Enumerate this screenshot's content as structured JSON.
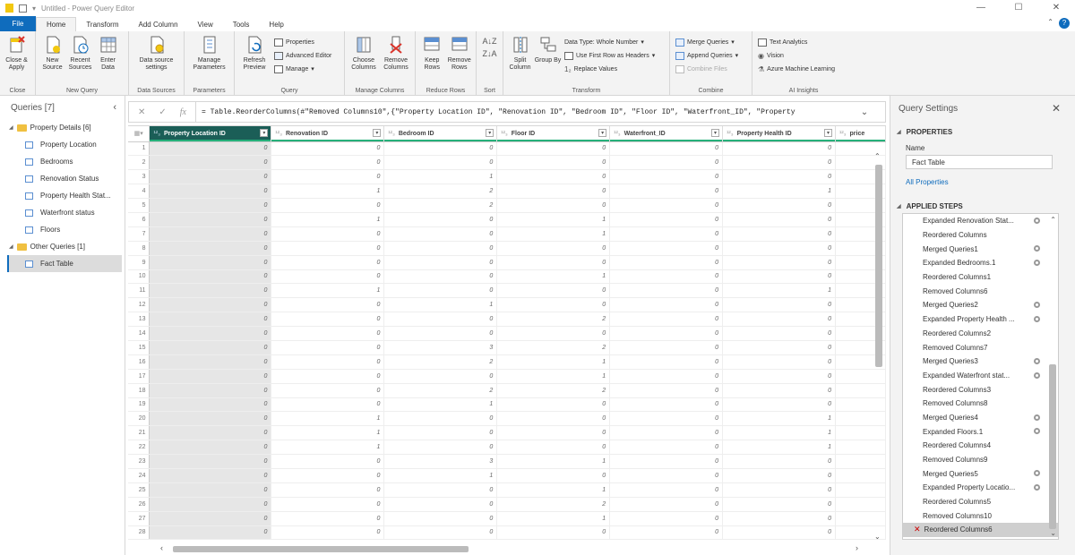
{
  "title": "Untitled - Power Query Editor",
  "window_controls": {
    "minimize": "—",
    "maximize": "☐",
    "close": "✕"
  },
  "tabs": [
    "File",
    "Home",
    "Transform",
    "Add Column",
    "View",
    "Tools",
    "Help"
  ],
  "ribbon": {
    "close": {
      "label": "Close",
      "btn": "Close & Apply"
    },
    "new_query": {
      "label": "New Query",
      "btns": [
        "New Source",
        "Recent Sources",
        "Enter Data"
      ]
    },
    "data_sources": {
      "label": "Data Sources",
      "btn": "Data source settings"
    },
    "parameters": {
      "label": "Parameters",
      "btn": "Manage Parameters"
    },
    "query": {
      "label": "Query",
      "btn": "Refresh Preview",
      "small": [
        "Properties",
        "Advanced Editor",
        "Manage"
      ]
    },
    "manage_columns": {
      "label": "Manage Columns",
      "btns": [
        "Choose Columns",
        "Remove Columns"
      ]
    },
    "reduce_rows": {
      "label": "Reduce Rows",
      "btns": [
        "Keep Rows",
        "Remove Rows"
      ]
    },
    "sort": {
      "label": "Sort"
    },
    "transform": {
      "label": "Transform",
      "btns": [
        "Split Column",
        "Group By"
      ],
      "small": [
        "Data Type: Whole Number",
        "Use First Row as Headers",
        "Replace Values"
      ]
    },
    "combine": {
      "label": "Combine",
      "small": [
        "Merge Queries",
        "Append Queries",
        "Combine Files"
      ]
    },
    "ai": {
      "label": "AI Insights",
      "small": [
        "Text Analytics",
        "Vision",
        "Azure Machine Learning"
      ]
    }
  },
  "queries": {
    "header": "Queries [7]",
    "groups": [
      {
        "name": "Property Details [6]",
        "items": [
          "Property Location",
          "Bedrooms",
          "Renovation Status",
          "Property Health Stat...",
          "Waterfront status",
          "Floors"
        ]
      },
      {
        "name": "Other Queries [1]",
        "items": [
          "Fact Table"
        ]
      }
    ]
  },
  "formula": "= Table.ReorderColumns(#\"Removed Columns10\",{\"Property Location ID\", \"Renovation ID\", \"Bedroom ID\", \"Floor ID\", \"Waterfront_ID\", \"Property",
  "columns": [
    "Property Location ID",
    "Renovation ID",
    "Bedroom ID",
    "Floor ID",
    "Waterfront_ID",
    "Property Health ID",
    "price"
  ],
  "column_type_icon": "¹²₃",
  "rows": [
    [
      0,
      0,
      0,
      0,
      0,
      0
    ],
    [
      0,
      0,
      0,
      0,
      0,
      0
    ],
    [
      0,
      0,
      1,
      0,
      0,
      0
    ],
    [
      0,
      1,
      2,
      0,
      0,
      1
    ],
    [
      0,
      0,
      2,
      0,
      0,
      0
    ],
    [
      0,
      1,
      0,
      1,
      0,
      0
    ],
    [
      0,
      0,
      0,
      1,
      0,
      0
    ],
    [
      0,
      0,
      0,
      0,
      0,
      0
    ],
    [
      0,
      0,
      0,
      0,
      0,
      0
    ],
    [
      0,
      0,
      0,
      1,
      0,
      0
    ],
    [
      0,
      1,
      0,
      0,
      0,
      1
    ],
    [
      0,
      0,
      1,
      0,
      0,
      0
    ],
    [
      0,
      0,
      0,
      2,
      0,
      0
    ],
    [
      0,
      0,
      0,
      0,
      0,
      0
    ],
    [
      0,
      0,
      3,
      2,
      0,
      0
    ],
    [
      0,
      0,
      2,
      1,
      0,
      0
    ],
    [
      0,
      0,
      0,
      1,
      0,
      0
    ],
    [
      0,
      0,
      2,
      2,
      0,
      0
    ],
    [
      0,
      0,
      1,
      0,
      0,
      0
    ],
    [
      0,
      1,
      0,
      0,
      0,
      1
    ],
    [
      0,
      1,
      0,
      0,
      0,
      1
    ],
    [
      0,
      1,
      0,
      0,
      0,
      1
    ],
    [
      0,
      0,
      3,
      1,
      0,
      0
    ],
    [
      0,
      0,
      1,
      0,
      0,
      0
    ],
    [
      0,
      0,
      0,
      1,
      0,
      0
    ],
    [
      0,
      0,
      0,
      2,
      0,
      0
    ],
    [
      0,
      0,
      0,
      1,
      0,
      0
    ],
    [
      0,
      0,
      0,
      0,
      0,
      0
    ]
  ],
  "settings": {
    "header": "Query Settings",
    "properties": "PROPERTIES",
    "name_label": "Name",
    "name_value": "Fact Table",
    "all_properties": "All Properties",
    "applied_steps": "APPLIED STEPS",
    "steps": [
      {
        "label": "Expanded Renovation Stat...",
        "gear": true
      },
      {
        "label": "Reordered Columns",
        "gear": false
      },
      {
        "label": "Merged Queries1",
        "gear": true
      },
      {
        "label": "Expanded Bedrooms.1",
        "gear": true
      },
      {
        "label": "Reordered Columns1",
        "gear": false
      },
      {
        "label": "Removed Columns6",
        "gear": false
      },
      {
        "label": "Merged Queries2",
        "gear": true
      },
      {
        "label": "Expanded Property Health ...",
        "gear": true
      },
      {
        "label": "Reordered Columns2",
        "gear": false
      },
      {
        "label": "Removed Columns7",
        "gear": false
      },
      {
        "label": "Merged Queries3",
        "gear": true
      },
      {
        "label": "Expanded Waterfront stat...",
        "gear": true
      },
      {
        "label": "Reordered Columns3",
        "gear": false
      },
      {
        "label": "Removed Columns8",
        "gear": false
      },
      {
        "label": "Merged Queries4",
        "gear": true
      },
      {
        "label": "Expanded Floors.1",
        "gear": true
      },
      {
        "label": "Reordered Columns4",
        "gear": false
      },
      {
        "label": "Removed Columns9",
        "gear": false
      },
      {
        "label": "Merged Queries5",
        "gear": true
      },
      {
        "label": "Expanded Property Locatio...",
        "gear": true
      },
      {
        "label": "Reordered Columns5",
        "gear": false
      },
      {
        "label": "Removed Columns10",
        "gear": false
      },
      {
        "label": "Reordered Columns6",
        "gear": false,
        "selected": true
      }
    ]
  },
  "colors": {
    "accent": "#0f6cbd",
    "selected_header": "#1b5e57",
    "quality_bar": "#26b07a"
  }
}
